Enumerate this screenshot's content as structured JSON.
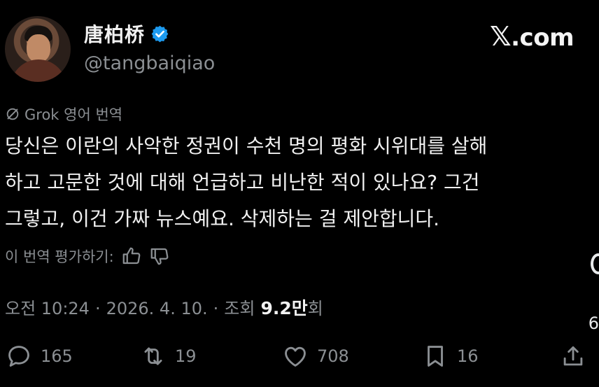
{
  "profile": {
    "display_name": "唐柏桥",
    "handle": "@tangbaiqiao",
    "avatar_icon": "avatar-photo",
    "verified_icon": "verified-badge-icon",
    "verified_color": "#1d9bf0"
  },
  "brand": {
    "x_mark": "𝕏",
    "domain": ".com"
  },
  "translation": {
    "label": "Grok 영어 번역",
    "icon": "grok-icon"
  },
  "tweet": {
    "lines": [
      "당신은 이란의 사악한 정권이 수천 명의 평화 시위대를 살해",
      "하고 고문한 것에 대해 언급하고 비난한 적이 있나요? 그건",
      "그렇고, 이건 가짜 뉴스예요. 삭제하는 걸 제안합니다."
    ]
  },
  "rating": {
    "label": "이 번역 평가하기:",
    "up_icon": "thumbs-up-icon",
    "down_icon": "thumbs-down-icon"
  },
  "meta": {
    "time": "오전 10:24",
    "sep1": "·",
    "date": "2026. 4. 10.",
    "sep2": "·",
    "views_label_prefix": "조회",
    "views_value": "9.2만",
    "views_label_suffix": "회"
  },
  "actions": {
    "reply_count": "165",
    "repost_count": "19",
    "like_count": "708",
    "bookmark_count": "16"
  },
  "edge": {
    "digit": "6"
  },
  "colors": {
    "background": "#000000",
    "text": "#e7e9ea",
    "muted": "#8b8f93",
    "accent": "#1d9bf0"
  }
}
